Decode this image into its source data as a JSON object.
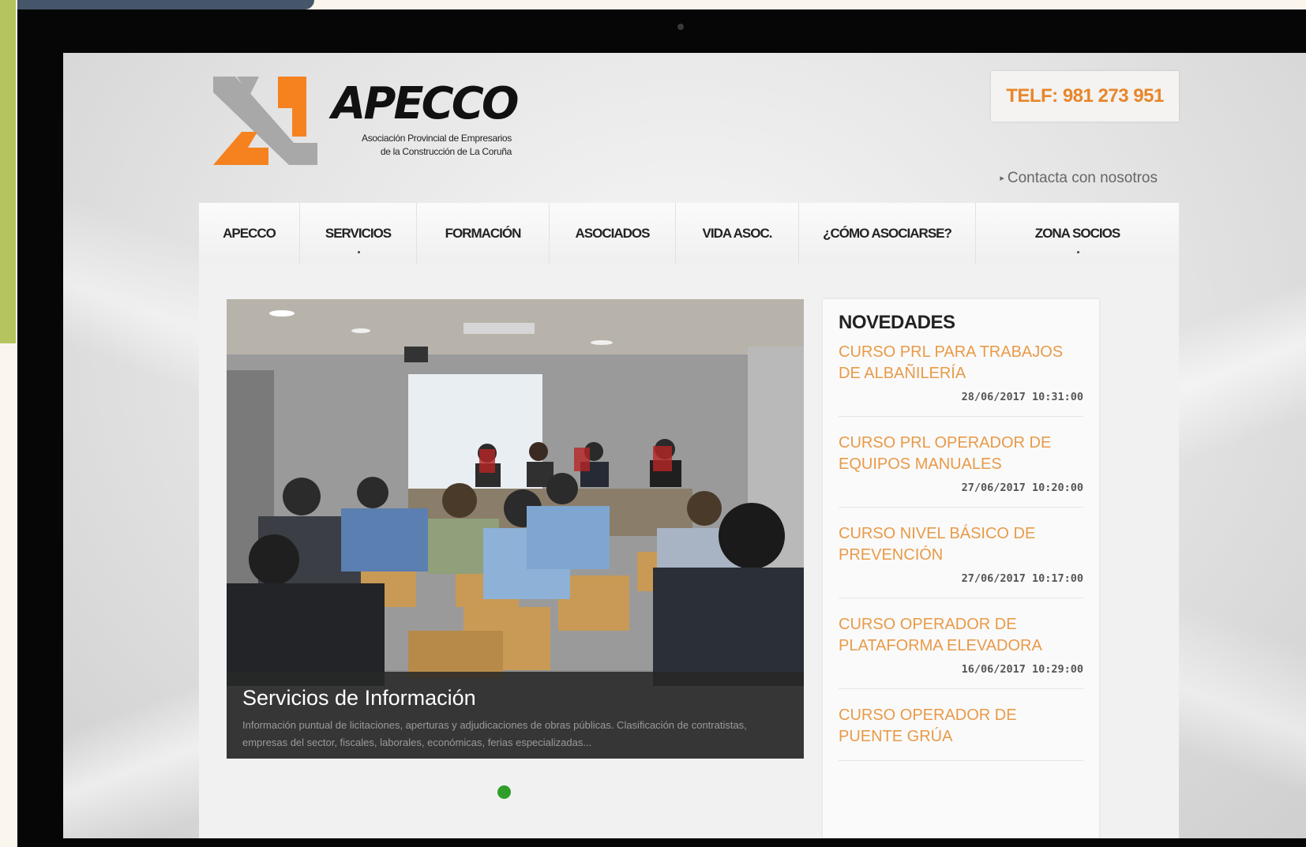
{
  "header": {
    "brand_name": "APECCO",
    "brand_subtitle_line1": "Asociación Provincial de Empresarios",
    "brand_subtitle_line2": "de la Construcción de La Coruña",
    "phone": "TELF: 981 273 951",
    "contact_link": "Contacta con nosotros"
  },
  "nav": {
    "items": [
      {
        "label": "APECCO"
      },
      {
        "label": "SERVICIOS"
      },
      {
        "label": "FORMACIÓN"
      },
      {
        "label": "ASOCIADOS"
      },
      {
        "label": "VIDA ASOC."
      },
      {
        "label": "¿CÓMO ASOCIARSE?"
      },
      {
        "label": "ZONA SOCIOS"
      }
    ]
  },
  "slider": {
    "title": "Servicios de Información",
    "text": "Información puntual de licitaciones, aperturas y adjudicaciones de obras públicas. Clasificación de contratistas, empresas del sector, fiscales, laborales, económicas, ferias especializadas..."
  },
  "news": {
    "title": "NOVEDADES",
    "items": [
      {
        "title": "CURSO PRL PARA TRABAJOS DE ALBAÑILERÍA",
        "date": "28/06/2017 10:31:00"
      },
      {
        "title": "CURSO PRL OPERADOR DE EQUIPOS MANUALES",
        "date": "27/06/2017 10:20:00"
      },
      {
        "title": "CURSO NIVEL BÁSICO DE PREVENCIÓN",
        "date": "27/06/2017 10:17:00"
      },
      {
        "title": "CURSO OPERADOR DE PLATAFORMA ELEVADORA",
        "date": "16/06/2017 10:29:00"
      },
      {
        "title": "CURSO OPERADOR DE PUENTE GRÚA",
        "date": ""
      }
    ]
  },
  "colors": {
    "accent_orange": "#e89a48",
    "logo_orange": "#f5821f",
    "logo_gray": "#a8a8a8",
    "slider_dot_active": "#2f9e2a"
  }
}
